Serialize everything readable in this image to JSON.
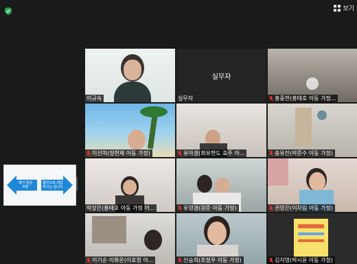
{
  "toolbar": {
    "view_label": "보기"
  },
  "share_screen": {
    "left_text": "제가 일상\n부분",
    "right_text": "물건으로 대답\n하시는 겁니다"
  },
  "colors": {
    "active_speaker": "#d6e23a",
    "muted_mic": "#e5322d"
  },
  "participants": [
    {
      "name": "이규숙",
      "muted": false
    },
    {
      "name": "실무자",
      "muted": false,
      "center_label": "실무자"
    },
    {
      "name": "홍중현(홍태호 아동 가정...",
      "muted": true
    },
    {
      "name": "이선미(정현제 아동 가정)",
      "muted": true
    },
    {
      "name": "유아경(최유현도 효주 아...",
      "muted": true
    },
    {
      "name": "송유진(박준수 아동 가정)",
      "muted": true
    },
    {
      "name": "박상은(홍태호 아동 가정 어...",
      "muted": false
    },
    {
      "name": "유영경(원준 아동 가정)",
      "muted": true
    },
    {
      "name": "권영은(이차림 아동 가정)",
      "muted": true
    },
    {
      "name": "이기순 이화운(이호청 아...",
      "muted": true
    },
    {
      "name": "신승희(조정우 아동 가정)",
      "muted": true
    },
    {
      "name": "김지영(박시윤 아동 가정)",
      "muted": true
    }
  ]
}
